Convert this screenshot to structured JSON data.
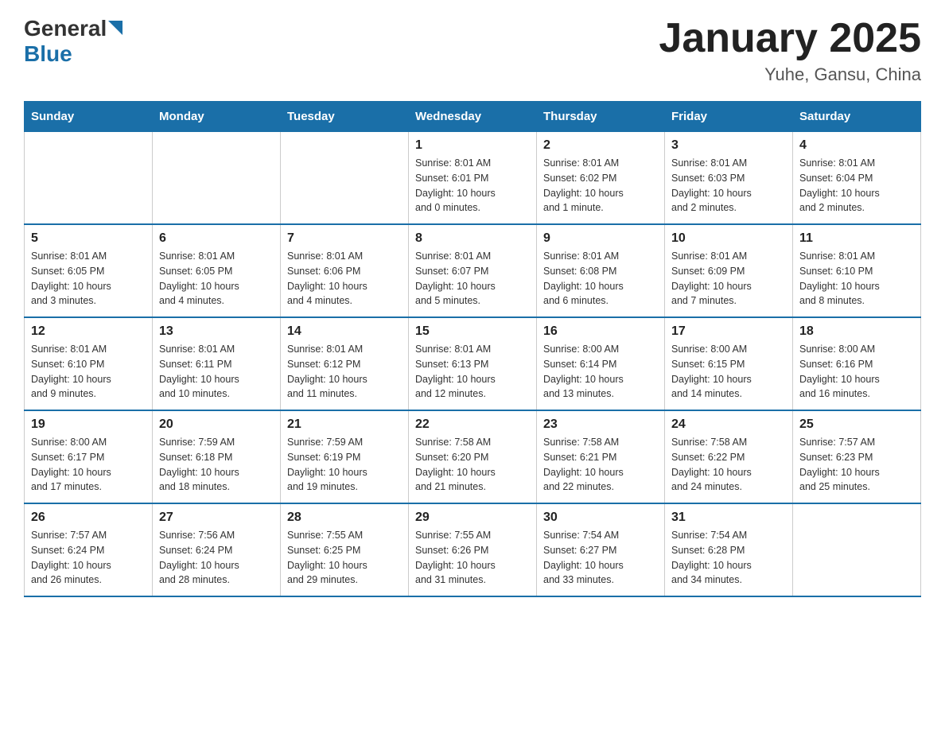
{
  "header": {
    "logo_general": "General",
    "logo_blue": "Blue",
    "title": "January 2025",
    "subtitle": "Yuhe, Gansu, China"
  },
  "days_of_week": [
    "Sunday",
    "Monday",
    "Tuesday",
    "Wednesday",
    "Thursday",
    "Friday",
    "Saturday"
  ],
  "weeks": [
    [
      {
        "day": "",
        "info": ""
      },
      {
        "day": "",
        "info": ""
      },
      {
        "day": "",
        "info": ""
      },
      {
        "day": "1",
        "info": "Sunrise: 8:01 AM\nSunset: 6:01 PM\nDaylight: 10 hours\nand 0 minutes."
      },
      {
        "day": "2",
        "info": "Sunrise: 8:01 AM\nSunset: 6:02 PM\nDaylight: 10 hours\nand 1 minute."
      },
      {
        "day": "3",
        "info": "Sunrise: 8:01 AM\nSunset: 6:03 PM\nDaylight: 10 hours\nand 2 minutes."
      },
      {
        "day": "4",
        "info": "Sunrise: 8:01 AM\nSunset: 6:04 PM\nDaylight: 10 hours\nand 2 minutes."
      }
    ],
    [
      {
        "day": "5",
        "info": "Sunrise: 8:01 AM\nSunset: 6:05 PM\nDaylight: 10 hours\nand 3 minutes."
      },
      {
        "day": "6",
        "info": "Sunrise: 8:01 AM\nSunset: 6:05 PM\nDaylight: 10 hours\nand 4 minutes."
      },
      {
        "day": "7",
        "info": "Sunrise: 8:01 AM\nSunset: 6:06 PM\nDaylight: 10 hours\nand 4 minutes."
      },
      {
        "day": "8",
        "info": "Sunrise: 8:01 AM\nSunset: 6:07 PM\nDaylight: 10 hours\nand 5 minutes."
      },
      {
        "day": "9",
        "info": "Sunrise: 8:01 AM\nSunset: 6:08 PM\nDaylight: 10 hours\nand 6 minutes."
      },
      {
        "day": "10",
        "info": "Sunrise: 8:01 AM\nSunset: 6:09 PM\nDaylight: 10 hours\nand 7 minutes."
      },
      {
        "day": "11",
        "info": "Sunrise: 8:01 AM\nSunset: 6:10 PM\nDaylight: 10 hours\nand 8 minutes."
      }
    ],
    [
      {
        "day": "12",
        "info": "Sunrise: 8:01 AM\nSunset: 6:10 PM\nDaylight: 10 hours\nand 9 minutes."
      },
      {
        "day": "13",
        "info": "Sunrise: 8:01 AM\nSunset: 6:11 PM\nDaylight: 10 hours\nand 10 minutes."
      },
      {
        "day": "14",
        "info": "Sunrise: 8:01 AM\nSunset: 6:12 PM\nDaylight: 10 hours\nand 11 minutes."
      },
      {
        "day": "15",
        "info": "Sunrise: 8:01 AM\nSunset: 6:13 PM\nDaylight: 10 hours\nand 12 minutes."
      },
      {
        "day": "16",
        "info": "Sunrise: 8:00 AM\nSunset: 6:14 PM\nDaylight: 10 hours\nand 13 minutes."
      },
      {
        "day": "17",
        "info": "Sunrise: 8:00 AM\nSunset: 6:15 PM\nDaylight: 10 hours\nand 14 minutes."
      },
      {
        "day": "18",
        "info": "Sunrise: 8:00 AM\nSunset: 6:16 PM\nDaylight: 10 hours\nand 16 minutes."
      }
    ],
    [
      {
        "day": "19",
        "info": "Sunrise: 8:00 AM\nSunset: 6:17 PM\nDaylight: 10 hours\nand 17 minutes."
      },
      {
        "day": "20",
        "info": "Sunrise: 7:59 AM\nSunset: 6:18 PM\nDaylight: 10 hours\nand 18 minutes."
      },
      {
        "day": "21",
        "info": "Sunrise: 7:59 AM\nSunset: 6:19 PM\nDaylight: 10 hours\nand 19 minutes."
      },
      {
        "day": "22",
        "info": "Sunrise: 7:58 AM\nSunset: 6:20 PM\nDaylight: 10 hours\nand 21 minutes."
      },
      {
        "day": "23",
        "info": "Sunrise: 7:58 AM\nSunset: 6:21 PM\nDaylight: 10 hours\nand 22 minutes."
      },
      {
        "day": "24",
        "info": "Sunrise: 7:58 AM\nSunset: 6:22 PM\nDaylight: 10 hours\nand 24 minutes."
      },
      {
        "day": "25",
        "info": "Sunrise: 7:57 AM\nSunset: 6:23 PM\nDaylight: 10 hours\nand 25 minutes."
      }
    ],
    [
      {
        "day": "26",
        "info": "Sunrise: 7:57 AM\nSunset: 6:24 PM\nDaylight: 10 hours\nand 26 minutes."
      },
      {
        "day": "27",
        "info": "Sunrise: 7:56 AM\nSunset: 6:24 PM\nDaylight: 10 hours\nand 28 minutes."
      },
      {
        "day": "28",
        "info": "Sunrise: 7:55 AM\nSunset: 6:25 PM\nDaylight: 10 hours\nand 29 minutes."
      },
      {
        "day": "29",
        "info": "Sunrise: 7:55 AM\nSunset: 6:26 PM\nDaylight: 10 hours\nand 31 minutes."
      },
      {
        "day": "30",
        "info": "Sunrise: 7:54 AM\nSunset: 6:27 PM\nDaylight: 10 hours\nand 33 minutes."
      },
      {
        "day": "31",
        "info": "Sunrise: 7:54 AM\nSunset: 6:28 PM\nDaylight: 10 hours\nand 34 minutes."
      },
      {
        "day": "",
        "info": ""
      }
    ]
  ]
}
